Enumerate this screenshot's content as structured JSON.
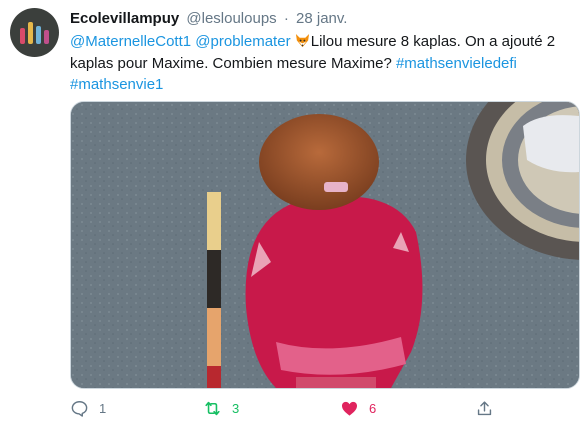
{
  "tweet": {
    "display_name": "Ecolevillampuy",
    "handle": "@leslouloups",
    "separator": "·",
    "date": "28 janv.",
    "mention_1": "@MaternelleCott1",
    "mention_2": "@problemater",
    "emoji": "fox-face-emoji",
    "body": "Lilou mesure 8 kaplas. On a ajouté 2 kaplas pour Maxime. Combien mesure Maxime?",
    "hashtag_1": "#mathsenvieledefi",
    "hashtag_2": "#mathsenvie1"
  },
  "actions": {
    "reply_count": "1",
    "retweet_count": "3",
    "like_count": "6",
    "reply_icon": "speech-bubble-icon",
    "retweet_icon": "retweet-arrows-icon",
    "like_icon": "heart-icon",
    "share_icon": "share-upload-icon"
  },
  "colors": {
    "link": "#1b95e0",
    "text": "#14171a",
    "muted": "#657786",
    "retweet_active": "#17bf63",
    "like_active": "#e0245e"
  }
}
